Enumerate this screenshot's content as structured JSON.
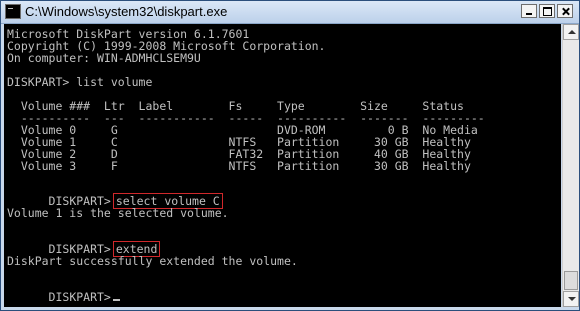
{
  "window": {
    "title": "C:\\Windows\\system32\\diskpart.exe",
    "minimize_label": "",
    "maximize_label": "",
    "close_label": ""
  },
  "console": {
    "header": [
      "Microsoft DiskPart version 6.1.7601",
      "Copyright (C) 1999-2008 Microsoft Corporation.",
      "On computer: WIN-ADMHCLSEM9U"
    ],
    "cmd_list_volume": "DISKPART> list volume",
    "table_header": "  Volume ###  Ltr  Label        Fs     Type        Size     Status",
    "table_divider": "  ----------  ---  -----------  -----  ----------  -------  ---------",
    "volumes": [
      "  Volume 0     G                       DVD-ROM         0 B  No Media",
      "  Volume 1     C                NTFS   Partition     30 GB  Healthy",
      "  Volume 2     D                FAT32  Partition     40 GB  Healthy",
      "  Volume 3     F                NTFS   Partition     30 GB  Healthy"
    ],
    "prompt": "DISKPART>",
    "cmd_select": "select volume C",
    "msg_selected": "Volume 1 is the selected volume.",
    "cmd_extend": "extend",
    "msg_extended": "DiskPart successfully extended the volume."
  },
  "colors": {
    "console_bg": "#000000",
    "console_text": "#c0c0c0",
    "highlight_border": "#d0282b"
  },
  "icons": {
    "app": "console-app-icon",
    "minimize": "minimize-icon",
    "maximize": "maximize-icon",
    "close": "close-icon"
  }
}
